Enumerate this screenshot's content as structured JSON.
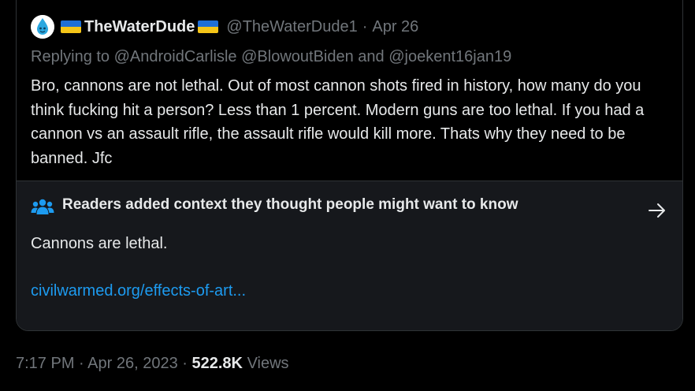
{
  "tweet": {
    "display_name": "TheWaterDude",
    "handle": "@TheWaterDude1",
    "separator": "·",
    "date": "Apr 26",
    "reply": {
      "prefix": "Replying to",
      "mention_1": "@AndroidCarlisle",
      "mention_2": "@BlowoutBiden",
      "conjunction": "and",
      "mention_3": "@joekent16jan19"
    },
    "text": "Bro, cannons are not lethal. Out of most cannon shots fired in history, how many do you think fucking hit a person? Less than 1 percent. Modern guns are too lethal. If you had a cannon vs an assault rifle, the assault rifle would kill more. Thats why they need to be banned. Jfc"
  },
  "community_note": {
    "title": "Readers added context they thought people might want to know",
    "body": "Cannons are lethal.",
    "link": "civilwarmed.org/effects-of-art..."
  },
  "footer": {
    "time": "7:17 PM",
    "separator": "·",
    "date": "Apr 26, 2023",
    "views_count": "522.8K",
    "views_label": "Views"
  },
  "colors": {
    "background": "#000000",
    "text": "#e7e9ea",
    "muted": "#71767b",
    "link": "#1d9bf0",
    "note_background": "#16181c",
    "border": "#2f3336",
    "flag_blue": "#1f6fd6",
    "flag_yellow": "#f5c518"
  },
  "icons": {
    "avatar": "water-drop-avatar",
    "note": "people-icon",
    "arrow": "arrow-right-icon"
  }
}
